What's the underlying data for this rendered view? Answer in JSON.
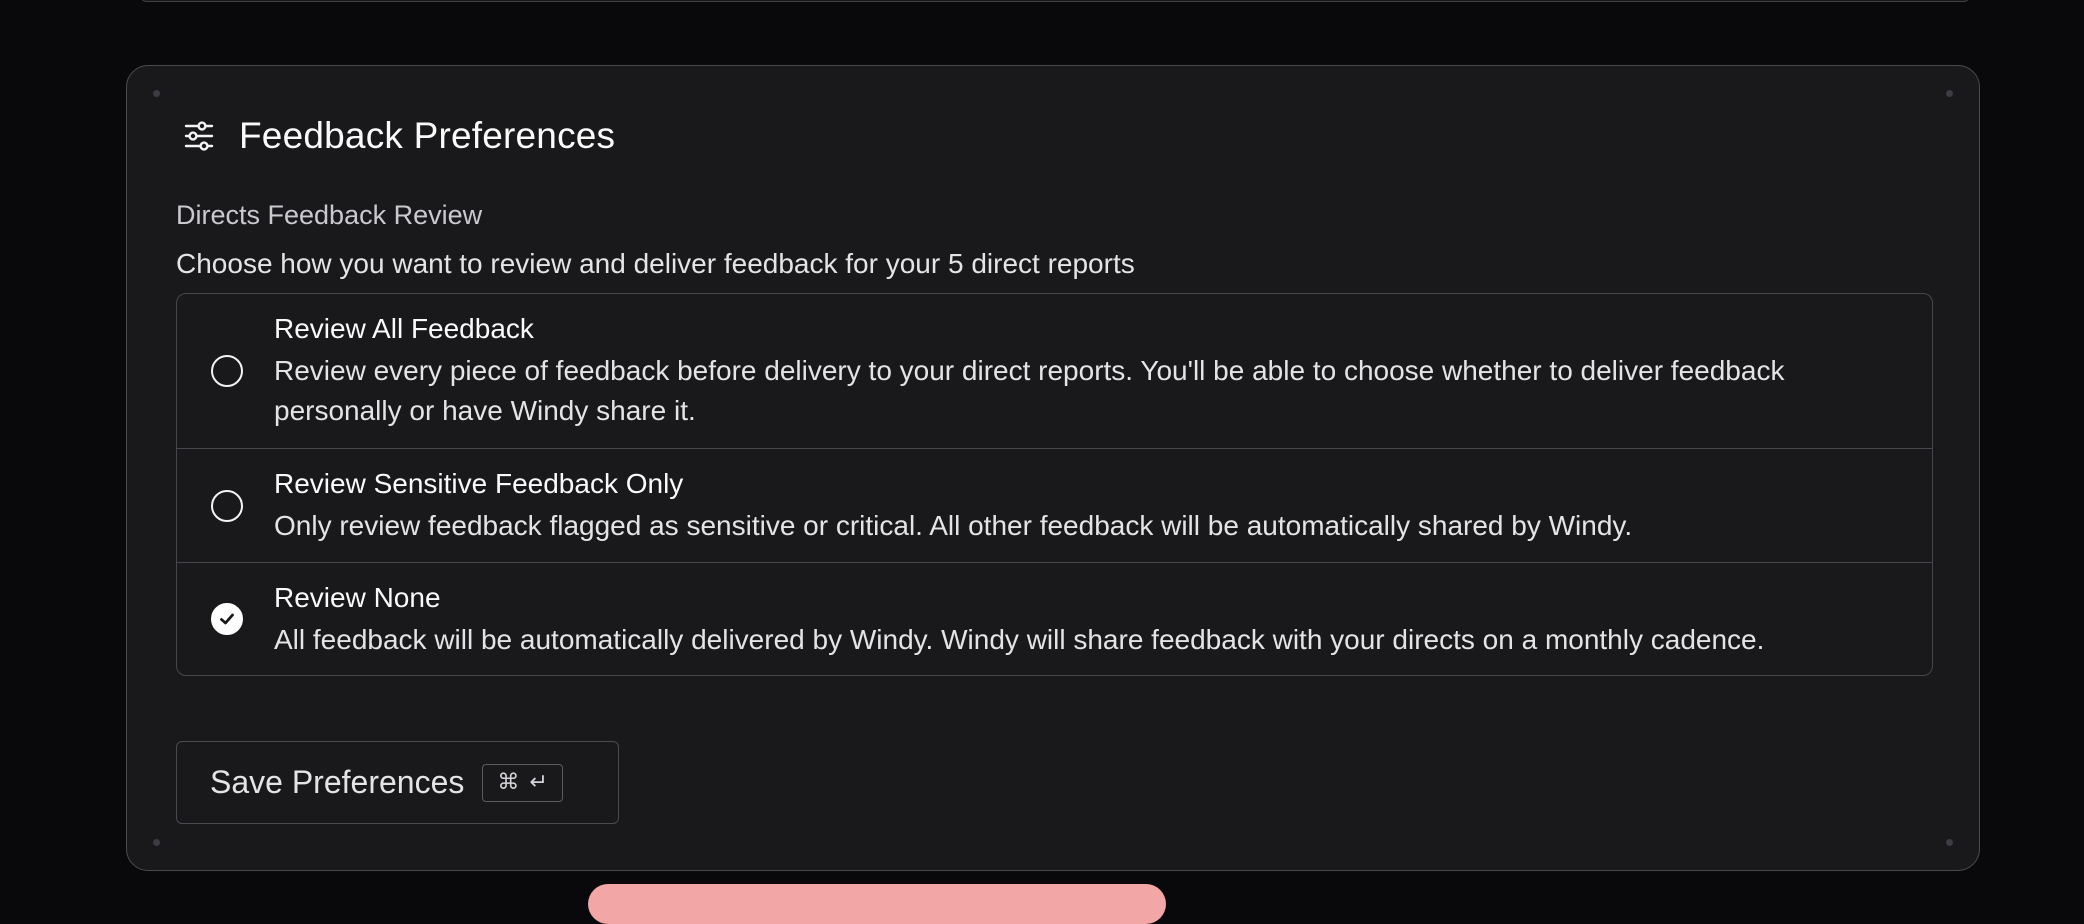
{
  "header": {
    "title": "Feedback Preferences",
    "icon": "sliders-icon"
  },
  "section": {
    "label": "Directs Feedback Review",
    "description": "Choose how you want to review and deliver feedback for your 5 direct reports"
  },
  "options": [
    {
      "title": "Review All Feedback",
      "description": "Review every piece of feedback before delivery to your direct reports. You'll be able to choose whether to deliver feedback personally or have Windy share it.",
      "selected": false
    },
    {
      "title": "Review Sensitive Feedback Only",
      "description": "Only review feedback flagged as sensitive or critical. All other feedback will be automatically shared by Windy.",
      "selected": false
    },
    {
      "title": "Review None",
      "description": "All feedback will be automatically delivered by Windy. Windy will share feedback with your directs on a monthly cadence.",
      "selected": true
    }
  ],
  "save_button": {
    "label": "Save Preferences",
    "shortcut_command": "⌘",
    "shortcut_enter": "↵"
  },
  "colors": {
    "background": "#09090b",
    "card": "#19191b",
    "border": "#46464c",
    "text": "#fafafa",
    "accent_peek": "#f3a6a6"
  }
}
